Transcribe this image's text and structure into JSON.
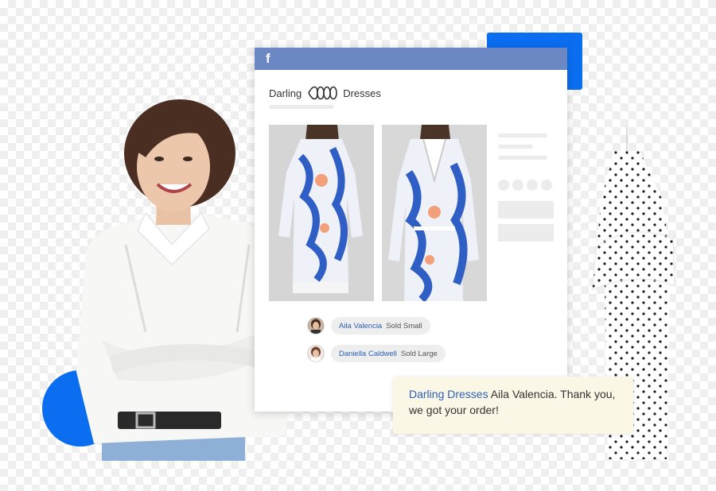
{
  "social": {
    "platform_icon": "facebook-icon",
    "icon_glyph": "f"
  },
  "post": {
    "brand_first": "Darling",
    "brand_second": "Dresses",
    "comments": [
      {
        "name": "Aila Valencia",
        "text": "Sold Small"
      },
      {
        "name": "Daniella Caldwell",
        "text": "Sold Large"
      }
    ]
  },
  "reply": {
    "brand": "Darling Dresses",
    "message": "Aila Valencia. Thank you, we got your order!"
  },
  "colors": {
    "brand_blue": "#0b6ef0",
    "facebook_bar": "#6b87c4",
    "link_blue": "#2b5fb8",
    "reply_bg": "#fbf7e7"
  }
}
